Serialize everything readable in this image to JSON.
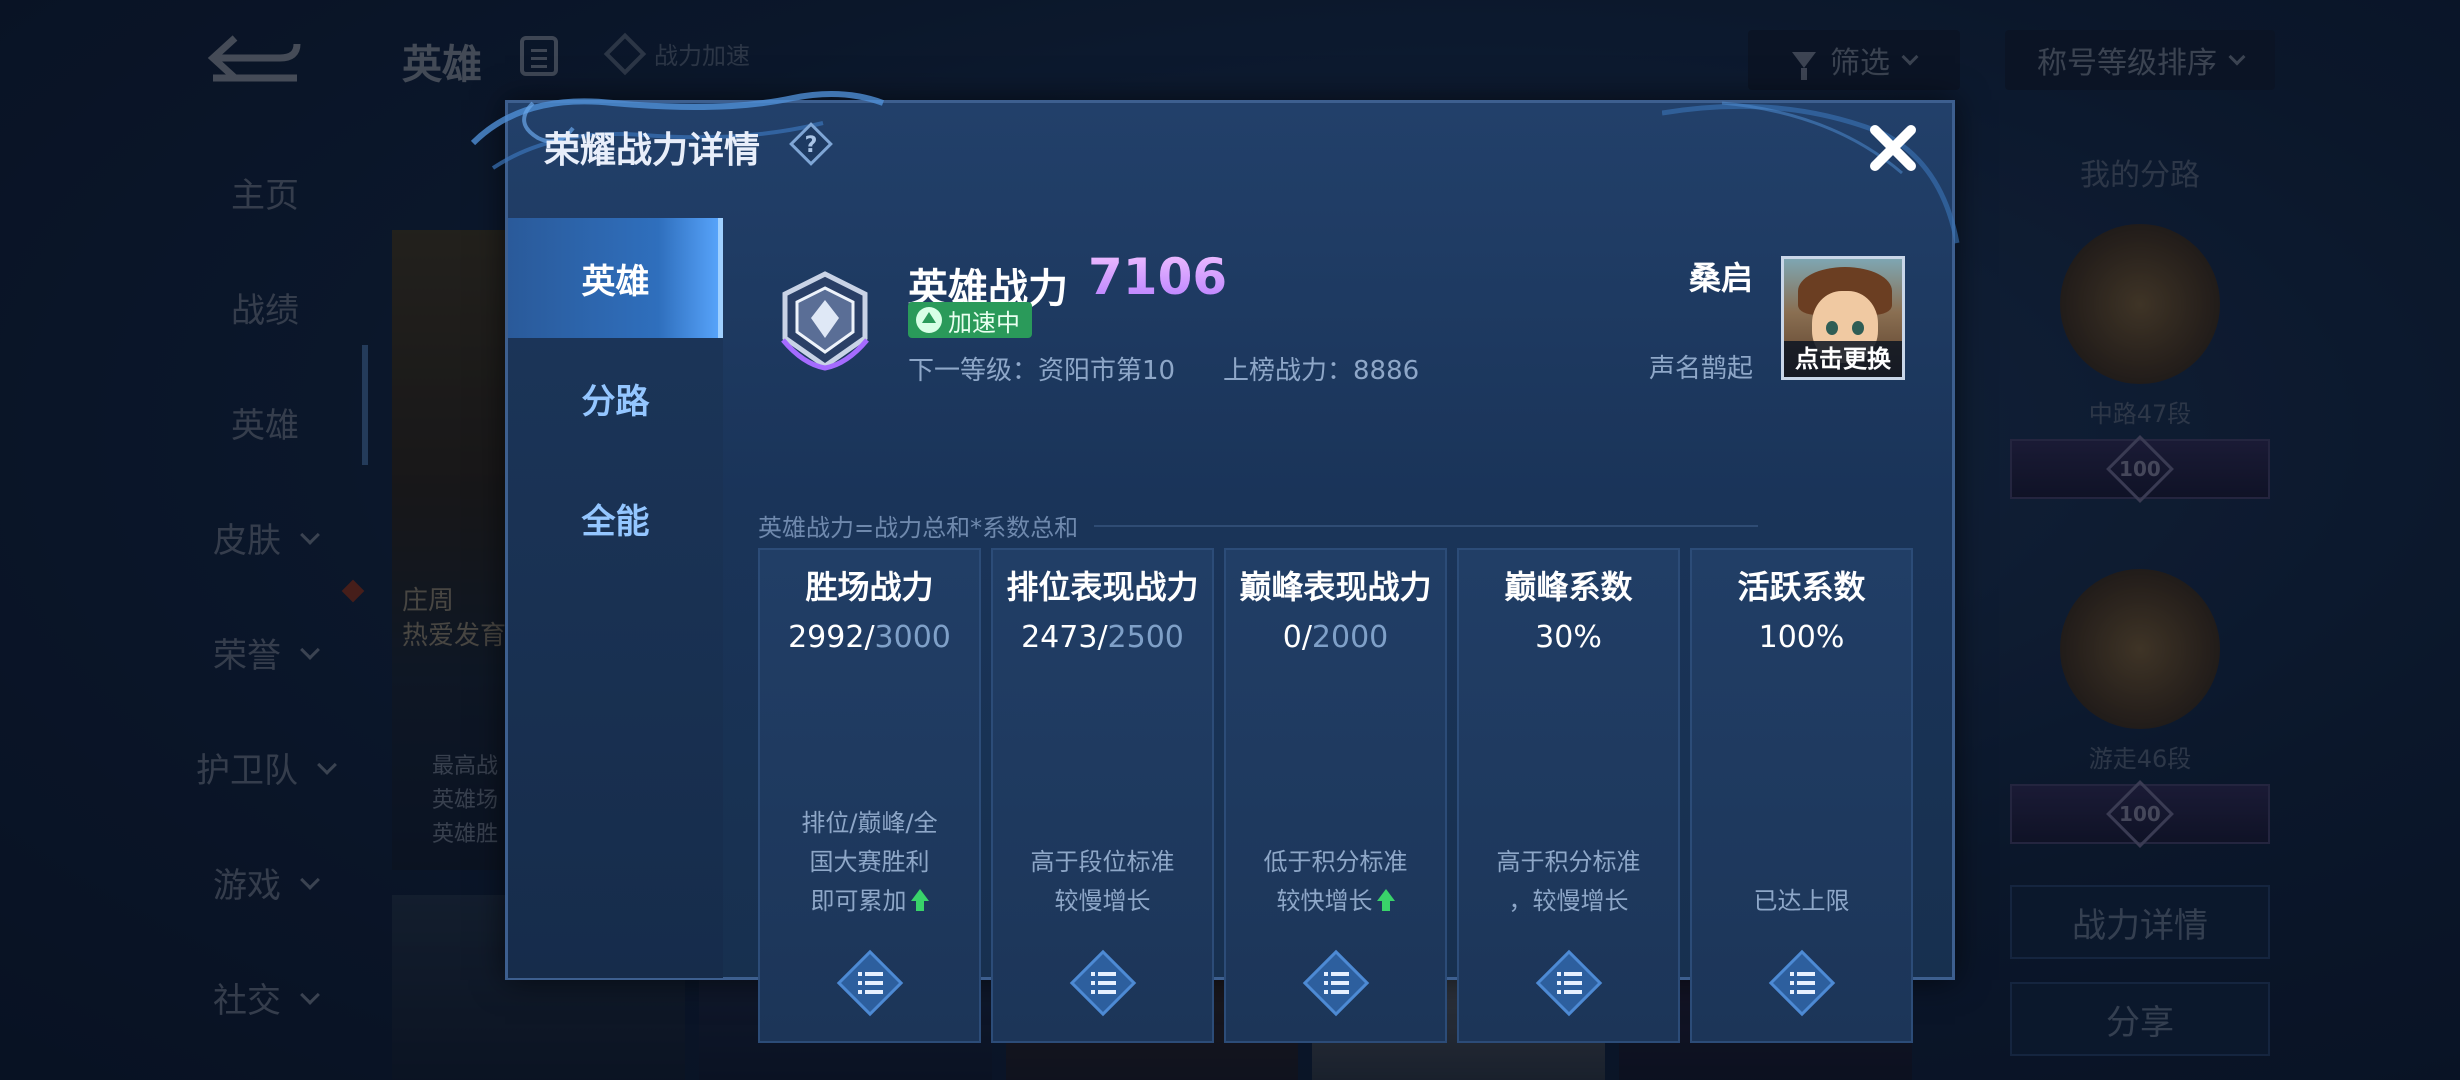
{
  "background": {
    "header": {
      "title": "英雄",
      "boost_label": "战力加速",
      "filter_label": "筛选",
      "sort_label": "称号等级排序"
    },
    "nav": [
      {
        "label": "主页"
      },
      {
        "label": "战绩"
      },
      {
        "label": "英雄"
      },
      {
        "label": "皮肤"
      },
      {
        "label": "荣誉"
      },
      {
        "label": "护卫队"
      },
      {
        "label": "游戏"
      },
      {
        "label": "社交"
      }
    ],
    "hero_card": {
      "name": "庄周",
      "tag": "热爱发育",
      "desc": [
        "最高战",
        "英雄场",
        "英雄胜"
      ]
    },
    "right_panel": {
      "title": "我的分路",
      "ranks": [
        {
          "label": "中路47段",
          "level": "100"
        },
        {
          "label": "游走46段",
          "level": "100"
        }
      ],
      "detail_button": "战力详情",
      "share_button": "分享"
    }
  },
  "modal": {
    "title": "荣耀战力详情",
    "tabs": [
      {
        "label": "英雄",
        "active": true
      },
      {
        "label": "分路",
        "active": false
      },
      {
        "label": "全能",
        "active": false
      }
    ],
    "power_label": "英雄战力",
    "power_value": "7106",
    "boost_tag": "加速中",
    "next_level": "下一等级：资阳市第10",
    "rank_power": "上榜战力：8886",
    "player_name": "桑启",
    "player_title": "声名鹊起",
    "avatar_caption": "点击更换",
    "formula": "英雄战力=战力总和*系数总和",
    "stats": [
      {
        "title": "胜场战力",
        "value": "2992",
        "max": "3000",
        "desc": [
          "排位/巅峰/全",
          "国大赛胜利",
          "即可累加"
        ],
        "arrow": true
      },
      {
        "title": "排位表现战力",
        "value": "2473",
        "max": "2500",
        "desc": [
          "高于段位标准",
          "较慢增长"
        ],
        "arrow": false
      },
      {
        "title": "巅峰表现战力",
        "value": "0",
        "max": "2000",
        "desc": [
          "低于积分标准",
          "较快增长"
        ],
        "arrow": true
      },
      {
        "title": "巅峰系数",
        "value": "30%",
        "max": "",
        "desc": [
          "高于积分标准",
          "，较慢增长"
        ],
        "arrow": false
      },
      {
        "title": "活跃系数",
        "value": "100%",
        "max": "",
        "desc": [
          "已达上限"
        ],
        "arrow": false
      }
    ]
  },
  "colors": {
    "power_value": "#e29bff",
    "boost_tag": "#2a9a5a",
    "active_tab": "#2f6fbd",
    "up_arrow": "#39d36a"
  }
}
